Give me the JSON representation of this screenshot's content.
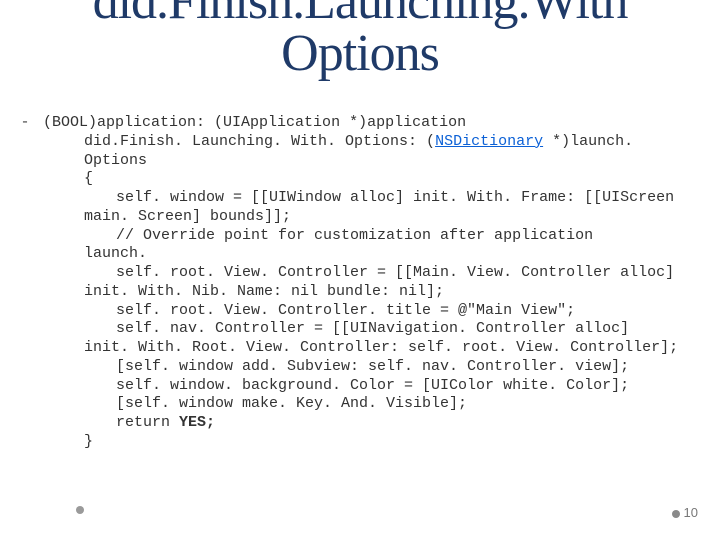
{
  "title_line1": "did.Finish.Launching.With",
  "title_line2": "Options",
  "code": {
    "sig1": "(BOOL)application: (UIApplication *)application",
    "sig2a": "did.Finish. Launching. With. Options: (",
    "sig2_link": "NSDictionary",
    "sig2b": " *)launch. Options",
    "brace_open": "{",
    "l1": "self. window = [[UIWindow alloc] init. With. Frame: [[UIScreen",
    "l1b": "main. Screen] bounds]];",
    "l2": "// Override point for customization after application",
    "l2b": "launch.",
    "l3": "self. root. View. Controller = [[Main. View. Controller alloc]",
    "l3b": "init. With. Nib. Name: nil bundle: nil];",
    "l4": "self. root. View. Controller. title = @\"Main View\";",
    "l5": "self. nav. Controller = [[UINavigation. Controller alloc]",
    "l5b": "init. With. Root. View. Controller: self. root. View. Controller];",
    "l6": "[self. window add. Subview: self. nav. Controller. view];",
    "l7": "self. window. background. Color = [UIColor white. Color];",
    "l8": "[self. window make. Key. And. Visible];",
    "ret_a": "return ",
    "ret_b": "YES;",
    "brace_close": "}"
  },
  "page_number": "10"
}
